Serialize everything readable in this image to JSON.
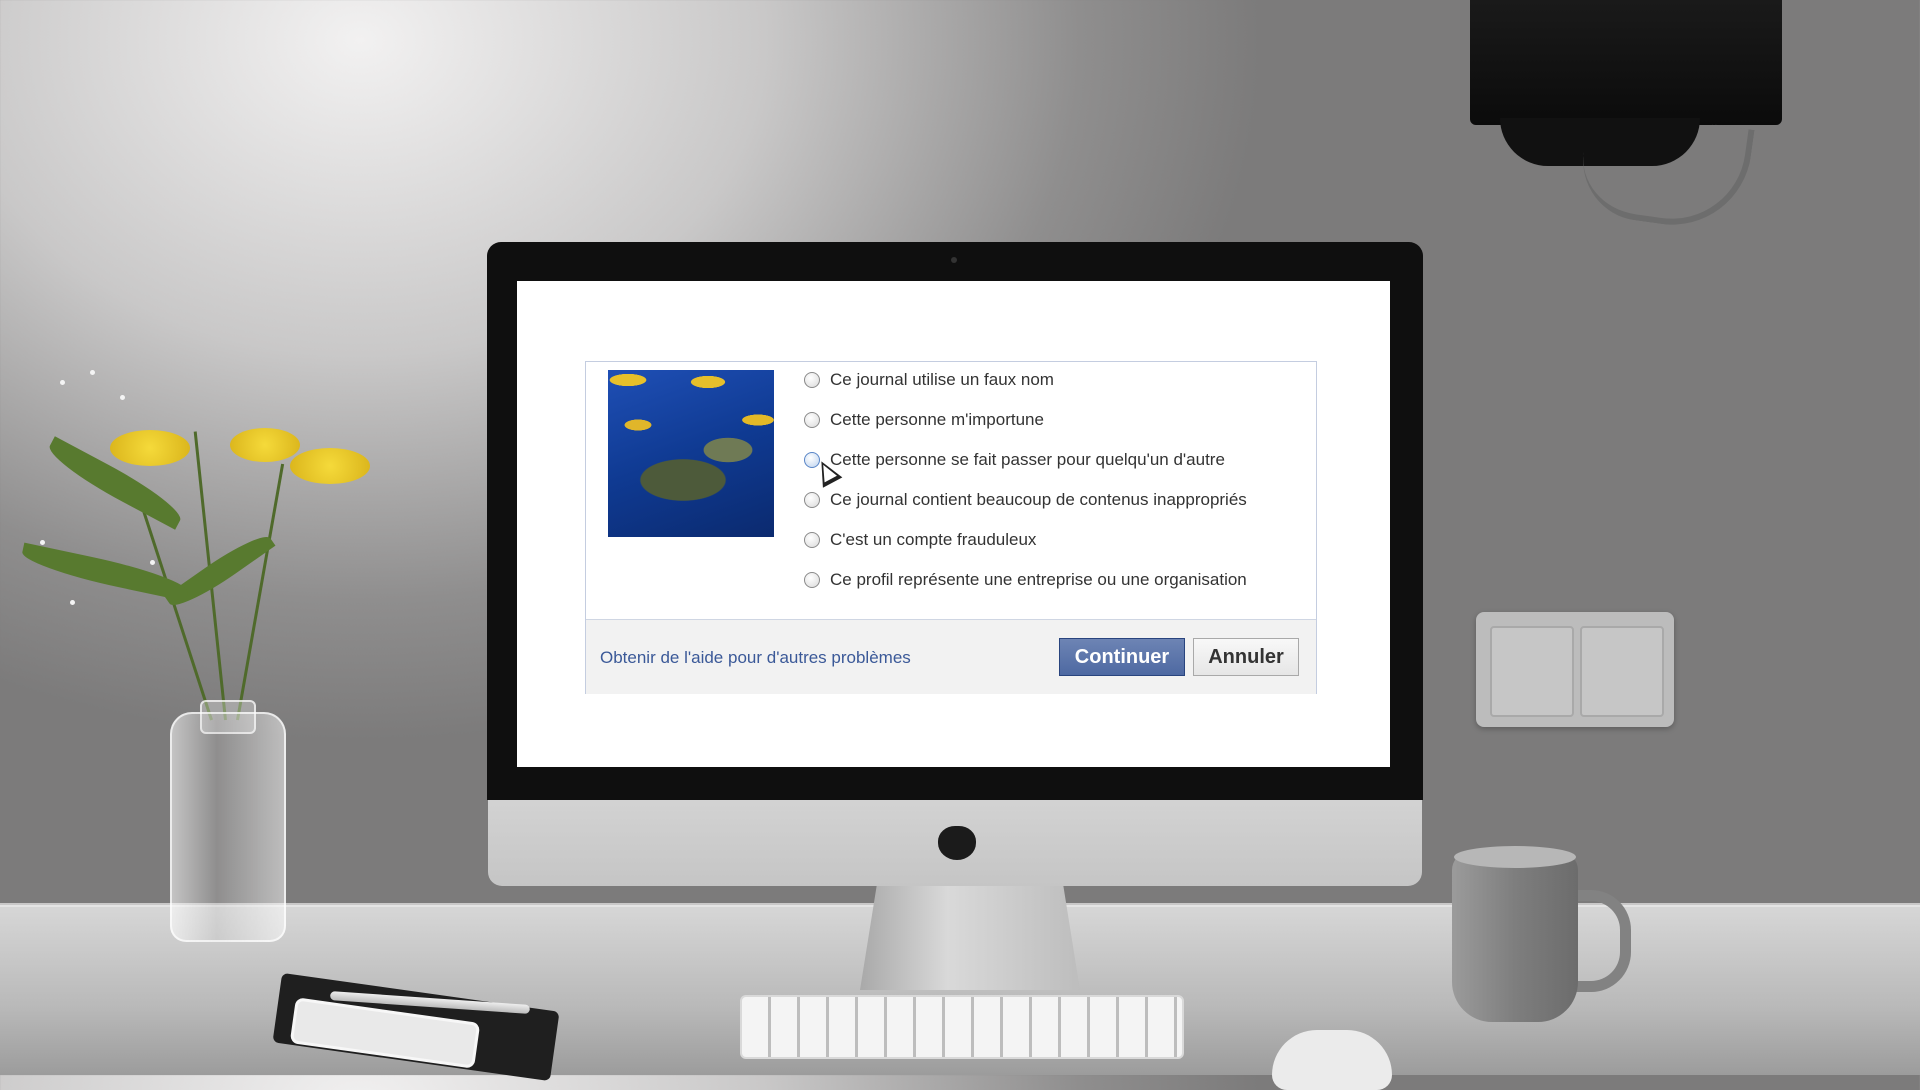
{
  "dialog": {
    "reasons": [
      "Ce journal utilise un faux nom",
      "Cette personne m'importune",
      "Cette personne se fait passer pour quelqu'un d'autre",
      "Ce journal contient beaucoup de contenus inappropriés",
      "C'est un compte frauduleux",
      "Ce profil représente une entreprise ou une organisation"
    ],
    "hovered_reason_index": 2,
    "help_link": "Obtenir de l'aide pour d'autres problèmes",
    "continue_label": "Continuer",
    "cancel_label": "Annuler"
  },
  "icons": {
    "profile_image": "sea-turtle-photo",
    "cursor": "mouse-pointer-icon"
  },
  "colors": {
    "primary_button": "#4e69a2",
    "link": "#3b5998",
    "dialog_border": "#c4cde0"
  }
}
